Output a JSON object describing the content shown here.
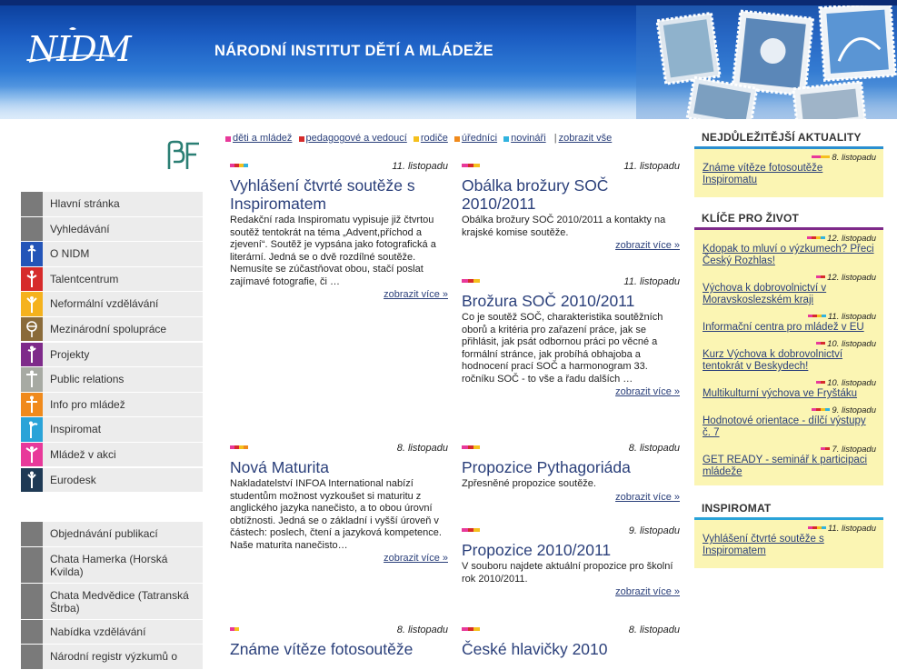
{
  "header": {
    "logo_text": "NIDM",
    "site_title": "NÁRODNÍ INSTITUT DĚTÍ A MLÁDEŽE"
  },
  "colors": {
    "pink": "#e8399a",
    "red": "#d62b2b",
    "yellow": "#f5c01d",
    "orange": "#f08a1c",
    "cyan": "#31b3df",
    "purple": "#7e2a8a",
    "link": "#2a3f7a",
    "highlight_bg": "#fbf5b3"
  },
  "sidebar": {
    "nav": [
      {
        "label": "Hlavní stránka",
        "color": "#7a7a7a",
        "icon": "none"
      },
      {
        "label": "Vyhledávání",
        "color": "#7a7a7a",
        "icon": "none"
      },
      {
        "label": "O NIDM",
        "color": "#2455b8",
        "icon": "figure-icon"
      },
      {
        "label": "Talentcentrum",
        "color": "#d62b2b",
        "icon": "figure-icon"
      },
      {
        "label": "Neformální vzdělávání",
        "color": "#f5b21d",
        "icon": "figure-icon"
      },
      {
        "label": "Mezinárodní spolupráce",
        "color": "#8a6b3a",
        "icon": "globe-figure-icon"
      },
      {
        "label": "Projekty",
        "color": "#7e2a8a",
        "icon": "figure-icon"
      },
      {
        "label": "Public relations",
        "color": "#a7aaa3",
        "icon": "figure-icon"
      },
      {
        "label": "Info pro mládež",
        "color": "#f08a1c",
        "icon": "figure-icon"
      },
      {
        "label": "Inspiromat",
        "color": "#2aa3d8",
        "icon": "figure-icon"
      },
      {
        "label": "Mládež v akci",
        "color": "#e8399a",
        "icon": "figure-icon"
      },
      {
        "label": "Eurodesk",
        "color": "#1f3a55",
        "icon": "figure-icon"
      }
    ],
    "secondary": [
      {
        "label": "Objednávání publikací"
      },
      {
        "label": "Chata Hamerka (Horská Kvilda)"
      },
      {
        "label": "Chata Medvědice (Tatranská Štrba)"
      },
      {
        "label": "Nabídka vzdělávání"
      },
      {
        "label": "Národní registr výzkumů o"
      }
    ]
  },
  "filters": [
    {
      "label": "děti a mládež",
      "color": "#e8399a"
    },
    {
      "label": "pedagogové a vedoucí",
      "color": "#d62b2b"
    },
    {
      "label": "rodiče",
      "color": "#f5c01d"
    },
    {
      "label": "úředníci",
      "color": "#f08a1c"
    },
    {
      "label": "novináři",
      "color": "#31b3df"
    }
  ],
  "filters_show_all": "zobrazit vše",
  "articles": [
    {
      "date": "11. listopadu",
      "title": "Vyhlášení čtvrté soutěže s Inspiromatem",
      "text": "Redakční rada Inspiromatu vypisuje již čtvrtou soutěž tentokrát na téma „Advent,příchod a zjevení“. Soutěž je vypsána jako fotografická a literární. Jedná se o dvě rozdílné soutěže. Nemusíte se zúčastňovat obou, stačí poslat zajímavé fotografie, či …",
      "more": "zobrazit více »"
    },
    {
      "date": "8. listopadu",
      "title": "Nová Maturita",
      "text": "Nakladatelství INFOA International nabízí studentům možnost vyzkoušet si maturitu z anglického jazyka nanečisto, a to obou úrovní obtížnosti. Jedná se o základní i vyšší úroveň v částech: poslech, čtení a jazyková kompetence. Naše maturita nanečisto…",
      "more": "zobrazit více »"
    },
    {
      "date": "8. listopadu",
      "title": "Známe vítěze fotosoutěže",
      "text": "",
      "more": ""
    },
    {
      "date": "11. listopadu",
      "title": "Obálka brožury SOČ 2010/2011",
      "text": "Obálka brožury SOČ 2010/2011 a kontakty na krajské komise soutěže.",
      "more": "zobrazit více »"
    },
    {
      "date": "11. listopadu",
      "title": "Brožura SOČ 2010/2011",
      "text": "Co je soutěž SOČ, charakteristika soutěžních oborů a kritéria pro zařazení práce, jak se přihlásit, jak psát odbornou práci po věcné a formální stránce, jak probíhá obhajoba a hodnocení prací SOČ a harmonogram 33. ročníku SOČ - to vše a řadu dalších …",
      "more": "zobrazit více »"
    },
    {
      "date": "8. listopadu",
      "title": "Propozice Pythagoriáda",
      "text": "Zpřesněné propozice soutěže.",
      "more": "zobrazit více »"
    },
    {
      "date": "9. listopadu",
      "title": "Propozice 2010/2011",
      "text": "V souboru najdete aktuální propozice pro školní rok 2010/2011.",
      "more": "zobrazit více »"
    },
    {
      "date": "8. listopadu",
      "title": "České hlavičky 2010",
      "text": "",
      "more": ""
    }
  ],
  "right": {
    "top_news": {
      "heading": "NEJDŮLEŽITĚJŠÍ AKTUALITY",
      "items": [
        {
          "date": "8. listopadu",
          "title": "Známe vítěze fotosoutěže Inspiromatu"
        }
      ]
    },
    "life_keys": {
      "heading": "KLÍČE PRO ŽIVOT",
      "items": [
        {
          "date": "12. listopadu",
          "title": "Kdopak to mluví o výzkumech? Přeci Český Rozhlas!"
        },
        {
          "date": "12. listopadu",
          "title": "Výchova k dobrovolnictví v Moravskoslezském kraji"
        },
        {
          "date": "11. listopadu",
          "title": "Informační centra pro mládež v EU"
        },
        {
          "date": "10. listopadu",
          "title": "Kurz Výchova k dobrovolnictví tentokrát v Beskydech!"
        },
        {
          "date": "10. listopadu",
          "title": "Multikulturní výchova ve Fryštáku"
        },
        {
          "date": "9. listopadu",
          "title": "Hodnotové orientace - dílčí výstupy č. 7"
        },
        {
          "date": "7. listopadu",
          "title": "GET READY - seminář k participaci mládeže"
        }
      ]
    },
    "inspiromat": {
      "heading": "INSPIROMAT",
      "items": [
        {
          "date": "11. listopadu",
          "title": "Vyhlášení čtvrté soutěže s Inspiromatem"
        }
      ]
    }
  }
}
